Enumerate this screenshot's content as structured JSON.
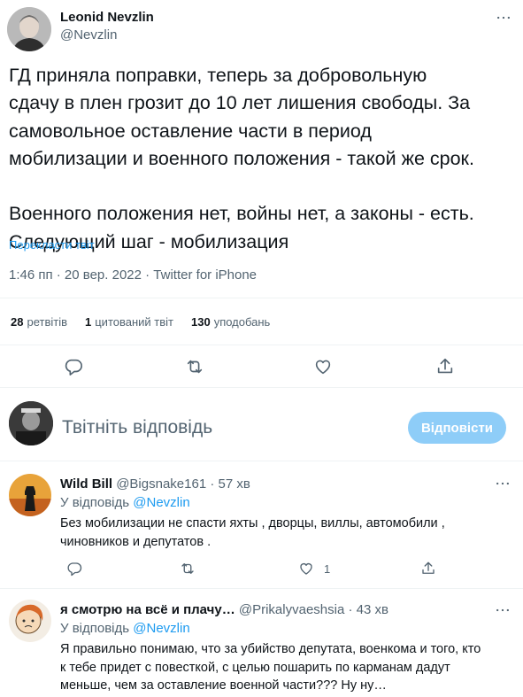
{
  "main_tweet": {
    "author_name": "Leonid Nevzlin",
    "author_handle": "@Nevzlin",
    "text": "ГД приняла поправки, теперь за добровольную\nсдачу в плен грозит до 10 лет лишения свободы. За\nсамовольное оставление части в период\nмобилизации и военного положения - такой же срок.\n\nВоенного положения нет, войны нет, а законы - есть.\nСледующий шаг - мобилизация",
    "translate_label": "Перекласти твіт",
    "meta": "1:46 пп · 20 вер. 2022 · Twitter for iPhone",
    "stats": [
      {
        "count": "28",
        "label": "ретвітів"
      },
      {
        "count": "1",
        "label": "цитований твіт"
      },
      {
        "count": "130",
        "label": "уподобань"
      }
    ],
    "icons": {
      "more": "more-icon",
      "reply": "reply-icon",
      "retweet": "retweet-icon",
      "like": "like-icon",
      "share": "share-icon"
    }
  },
  "compose": {
    "placeholder": "Твітніть відповідь",
    "button_label": "Відповісти"
  },
  "replies": [
    {
      "name": "Wild Bill",
      "handle_time": "@Bigsnake161 · 57 хв",
      "reply_prefix": "У відповідь",
      "reply_to": "@Nevzlin",
      "text": "Без мобилизации не спасти яхты , дворцы, виллы, автомобили ,\nчиновников и депутатов .",
      "like_count": "1"
    },
    {
      "name": "я смотрю на всё и плачу…",
      "handle_time": "@Prikalyvaeshsia · 43 хв",
      "reply_prefix": "У відповідь",
      "reply_to": "@Nevzlin",
      "text": "Я правильно понимаю, что за убийство депутата, военкома и того, кто\nк тебе придет с повесткой, с целью пошарить по карманам дадут\nменьше, чем за оставление военной части??? Ну ну…",
      "like_count": ""
    }
  ],
  "colors": {
    "accent": "#1d9bf0",
    "secondary_text": "#536471",
    "primary_text": "#0f1419",
    "button_disabled": "#8ecdf8",
    "divider": "#eff3f4"
  }
}
